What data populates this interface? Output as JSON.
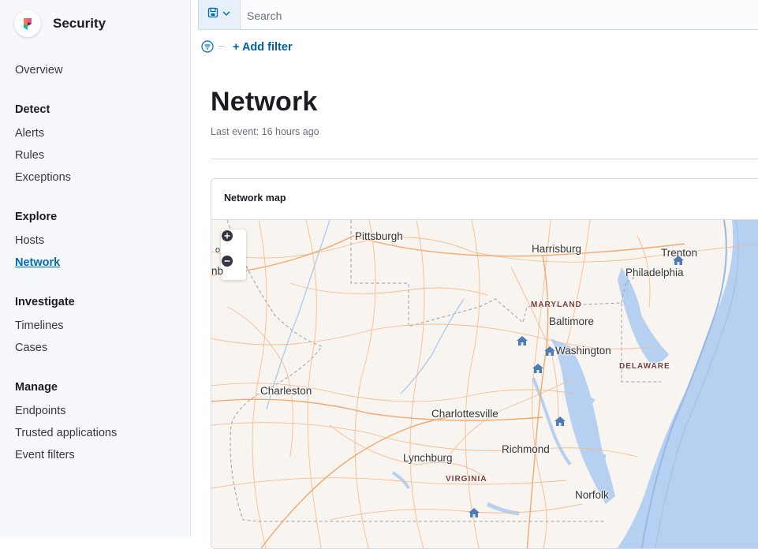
{
  "app": {
    "title": "Security"
  },
  "nav": {
    "overview": "Overview",
    "groups": [
      {
        "label": "Detect",
        "items": [
          "Alerts",
          "Rules",
          "Exceptions"
        ]
      },
      {
        "label": "Explore",
        "items": [
          "Hosts",
          "Network"
        ]
      },
      {
        "label": "Investigate",
        "items": [
          "Timelines",
          "Cases"
        ]
      },
      {
        "label": "Manage",
        "items": [
          "Endpoints",
          "Trusted applications",
          "Event filters"
        ]
      }
    ],
    "active": "Network"
  },
  "query": {
    "placeholder": "Search",
    "add_filter": "+ Add filter"
  },
  "page": {
    "title": "Network",
    "last_event": "Last event: 16 hours ago"
  },
  "map_panel": {
    "title": "Network map",
    "cities": [
      "Pittsburgh",
      "Harrisburg",
      "Trenton",
      "Philadelphia",
      "Baltimore",
      "Washington",
      "Charleston",
      "Charlottesville",
      "Richmond",
      "Lynchburg",
      "Norfolk"
    ],
    "states": [
      "MARYLAND",
      "DELAWARE",
      "VIRGINIA"
    ],
    "edge_labels": [
      "o",
      "nb"
    ]
  },
  "colors": {
    "accent": "#006bb8",
    "link": "#0061a6",
    "water": "#b5d0f0",
    "marker": "#4f7bb3"
  },
  "icons": {
    "logo": "elastic-security-logo",
    "saved_query": "saved-query-icon",
    "chevron": "chevron-down-icon",
    "filter": "filter-icon",
    "zoom_in": "plus-circle-icon",
    "zoom_out": "minus-circle-icon",
    "marker": "house-icon"
  }
}
